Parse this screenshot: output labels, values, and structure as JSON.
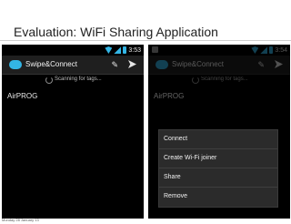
{
  "slide": {
    "title": "Evaluation: WiFi Sharing Application",
    "footer": "Monday 28 January 13"
  },
  "phones": [
    {
      "status_time": "3:53",
      "app_title": "Swipe&Connect",
      "scan_text": "Scanning for tags...",
      "list_item": "AirPROG",
      "icons": [
        "wifi-icon",
        "signal-icon",
        "battery-icon",
        "app-icon",
        "pen-icon",
        "send-icon",
        "spinner-icon"
      ]
    },
    {
      "status_time": "3:54",
      "app_title": "Swipe&Connect",
      "scan_text": "Scanning for tags...",
      "list_item": "AirPROG",
      "context_menu": [
        "Connect",
        "Create Wi-Fi joiner",
        "Share",
        "Remove"
      ],
      "icons": [
        "notification-icon",
        "wifi-icon",
        "signal-icon",
        "battery-icon",
        "app-icon",
        "pen-icon",
        "send-icon",
        "spinner-icon"
      ]
    }
  ],
  "colors": {
    "accent": "#33b5e5",
    "phone_bg": "#000000",
    "menu_bg": "#2b2b2b"
  }
}
